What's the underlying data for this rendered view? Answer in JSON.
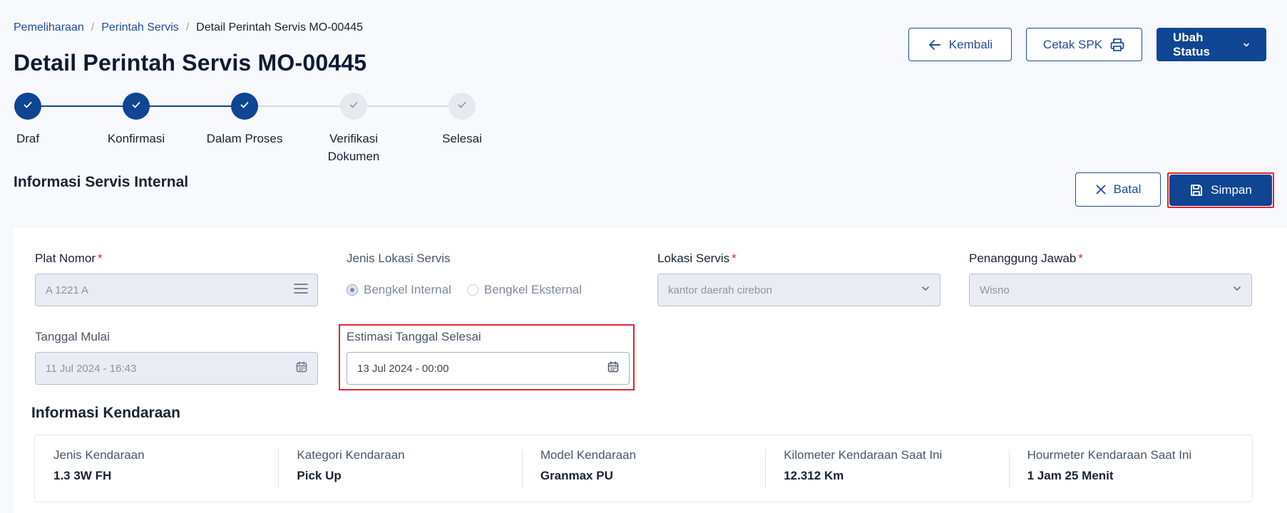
{
  "breadcrumb": {
    "items": [
      "Pemeliharaan",
      "Perintah Servis"
    ],
    "separator": "/",
    "current": "Detail Perintah Servis MO-00445"
  },
  "page_title": "Detail Perintah Servis MO-00445",
  "top_actions": {
    "back_label": "Kembali",
    "print_label": "Cetak SPK",
    "status_label": "Ubah Status"
  },
  "stepper": {
    "steps": [
      {
        "label": "Draf",
        "done": true
      },
      {
        "label": "Konfirmasi",
        "done": true
      },
      {
        "label": "Dalam Proses",
        "done": true
      },
      {
        "label_line1": "Verifikasi",
        "label_line2": "Dokumen",
        "done": false
      },
      {
        "label": "Selesai",
        "done": false
      }
    ]
  },
  "section_title": "Informasi Servis Internal",
  "form_actions": {
    "cancel_label": "Batal",
    "save_label": "Simpan"
  },
  "form": {
    "plate": {
      "label": "Plat Nomor",
      "required": "*",
      "value": "A 1221 A"
    },
    "location_type": {
      "label": "Jenis Lokasi Servis",
      "options": [
        "Bengkel Internal",
        "Bengkel Eksternal"
      ],
      "selected": "Bengkel Internal"
    },
    "location": {
      "label": "Lokasi Servis",
      "required": "*",
      "value": "kantor daerah cirebon"
    },
    "pic": {
      "label": "Penanggung Jawab",
      "required": "*",
      "value": "Wisno"
    },
    "start_date": {
      "label": "Tanggal Mulai",
      "value": "11 Jul 2024 - 16:43"
    },
    "end_date": {
      "label": "Estimasi Tanggal Selesai",
      "value": "13 Jul 2024 - 00:00"
    }
  },
  "vehicle": {
    "title": "Informasi Kendaraan",
    "fields": [
      {
        "label": "Jenis Kendaraan",
        "value": "1.3 3W FH"
      },
      {
        "label": "Kategori Kendaraan",
        "value": "Pick Up"
      },
      {
        "label": "Model Kendaraan",
        "value": "Granmax PU"
      },
      {
        "label": "Kilometer Kendaraan Saat Ini",
        "value": "12.312 Km"
      },
      {
        "label": "Hourmeter Kendaraan Saat Ini",
        "value": "1 Jam 25 Menit"
      }
    ]
  },
  "colors": {
    "primary": "#0f4592",
    "link": "#1f4d99",
    "highlight": "#e0262e",
    "required": "#e0262e"
  },
  "icons": {
    "back": "arrow-left-icon",
    "print": "printer-icon",
    "status": "chevron-down-icon",
    "cancel": "close-icon",
    "save": "floppy-disk-icon",
    "plate": "list-icon",
    "dropdown": "chevron-down-icon",
    "date": "calendar-icon",
    "step": "check-icon"
  }
}
